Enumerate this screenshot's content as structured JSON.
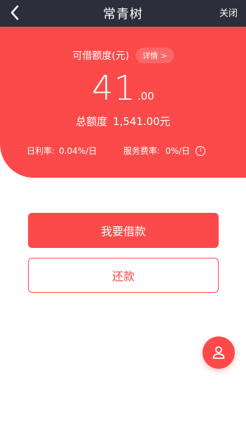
{
  "theme": {
    "accent": "#fc4a4a",
    "navbar_bg": "#2c2f3b",
    "background": "#ffffff"
  },
  "navbar": {
    "back_icon": "chevron-left-icon",
    "title": "常青树",
    "close_label": "关闭"
  },
  "credit": {
    "label": "可借额度(元)",
    "detail_label": "详情",
    "detail_icon": ">",
    "amount_integer": "41",
    "amount_decimal": ".00",
    "total_label": "总额度",
    "total_value": "1,541.00元"
  },
  "rates": {
    "daily_label": "日利率:",
    "daily_value": "0.04%/日",
    "service_label": "服务费率:",
    "service_value": "0%/日",
    "info_icon": "info-icon",
    "info_glyph": "i"
  },
  "actions": {
    "borrow_label": "我要借款",
    "repay_label": "还款"
  },
  "fab": {
    "icon": "user-icon"
  }
}
